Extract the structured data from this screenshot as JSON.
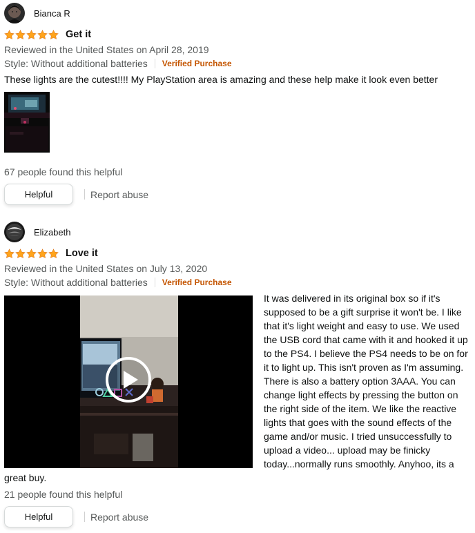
{
  "reviews": [
    {
      "profile_name": "Bianca R",
      "rating": 5,
      "title": "Get it",
      "reviewed": "Reviewed in the United States on April 28, 2019",
      "style": "Style: Without additional batteries",
      "verified": "Verified Purchase",
      "body": "These lights are the cutest!!!! My PlayStation area is amazing and these help make it look even better",
      "helpful_count": "67 people found this helpful",
      "helpful_button": "Helpful",
      "report": "Report abuse"
    },
    {
      "profile_name": "Elizabeth",
      "rating": 5,
      "title": "Love it",
      "reviewed": "Reviewed in the United States on July 13, 2020",
      "style": "Style: Without additional batteries",
      "verified": "Verified Purchase",
      "body": " It was delivered in its original box so if it's supposed to be a gift surprise it won't be. I like that it's light weight and easy to use. We used the USB cord that came with it and hooked it up to the PS4. I believe the PS4 needs to be on for it to light up. This isn't proven as I'm assuming. There is also a battery option 3AAA. You can change light effects by pressing the button on the right side of the item. We like the reactive lights that goes with the sound effects of the game and/or music. I tried unsuccessfully to upload a video... upload may be finicky today...normally runs smoothly. Anyhoo, its a great buy.",
      "helpful_count": "21 people found this helpful",
      "helpful_button": "Helpful",
      "report": "Report abuse"
    }
  ],
  "colors": {
    "star": "#ffa41c",
    "verified": "#c45500",
    "meta": "#565959"
  },
  "icons": {
    "star": "star-icon",
    "play": "play-icon"
  }
}
